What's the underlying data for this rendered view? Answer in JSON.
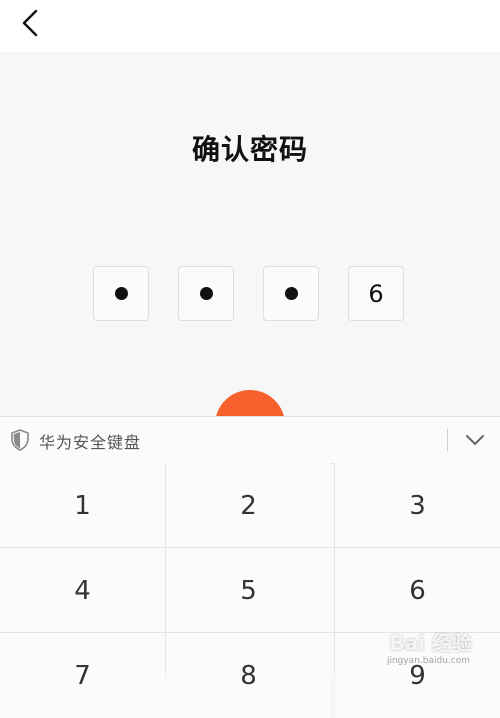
{
  "header": {
    "back_icon": "chevron-left-icon",
    "title": "确认密码"
  },
  "pin": {
    "digits": [
      "•",
      "•",
      "•",
      "6"
    ],
    "entered_count": 4
  },
  "confirm_button": {
    "color": "#f5602b"
  },
  "keyboard": {
    "title": "华为安全键盘",
    "shield_icon": "shield-icon",
    "collapse_icon": "chevron-down-icon",
    "keys": [
      "1",
      "2",
      "3",
      "4",
      "5",
      "6",
      "7",
      "8",
      "9"
    ]
  },
  "watermark": {
    "text": "Bai 经验",
    "sub": "jingyan.baidu.com"
  }
}
